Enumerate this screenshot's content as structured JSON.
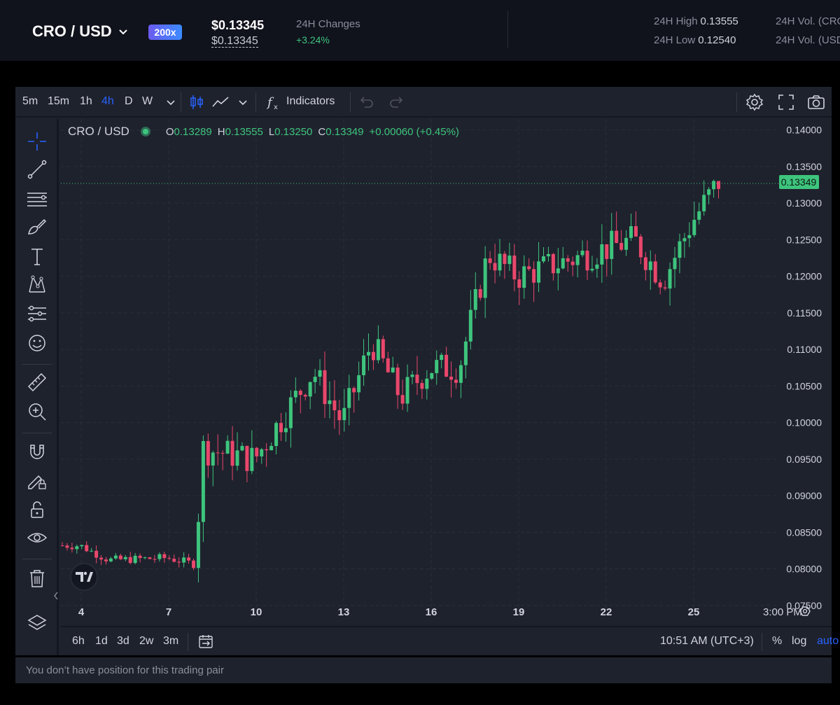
{
  "header": {
    "pair": "CRO / USD",
    "leverage": "200x",
    "price": "$0.13345",
    "price_sub": "$0.13345",
    "changes_label": "24H Changes",
    "changes_value": "+3.24%",
    "high_label": "24H High",
    "high_value": "0.13555",
    "low_label": "24H Low",
    "low_value": "0.12540",
    "vol1_label": "24H Vol. (CRO",
    "vol2_label": "24H Vol. (USD"
  },
  "toolbar": {
    "intervals": [
      "5m",
      "15m",
      "1h",
      "4h",
      "D",
      "W"
    ],
    "active_interval": "4h",
    "indicators_label": "Indicators"
  },
  "legend": {
    "symbol": "CRO / USD",
    "o_label": "O",
    "o_value": "0.13289",
    "h_label": "H",
    "h_value": "0.13555",
    "l_label": "L",
    "l_value": "0.13250",
    "c_label": "C",
    "c_value": "0.13349",
    "change": "+0.00060 (+0.45%)"
  },
  "bottombar": {
    "ranges": [
      "6h",
      "1d",
      "3d",
      "2w",
      "3m"
    ],
    "time": "10:51 AM (UTC+3)",
    "percent": "%",
    "log": "log",
    "auto": "auto"
  },
  "position_message": "You don’t have position for this trading pair",
  "colors": {
    "up": "#3ec47d",
    "down": "#e9476b",
    "accent": "#2962ff"
  },
  "chart_data": {
    "type": "candlestick",
    "ylim": [
      0.0745,
      0.1415
    ],
    "y_ticks": [
      "0.14000",
      "0.13500",
      "0.13000",
      "0.12500",
      "0.12000",
      "0.11500",
      "0.11000",
      "0.10500",
      "0.10000",
      "0.09500",
      "0.09000",
      "0.08500",
      "0.08000",
      "0.07500"
    ],
    "x_ticks": [
      "4",
      "7",
      "10",
      "13",
      "16",
      "19",
      "22",
      "25",
      "3:00 PM"
    ],
    "last_price": 0.13349,
    "last_price_label": "0.13349",
    "key_closes": [
      {
        "day": "4",
        "close": 0.0832
      },
      {
        "day": "5",
        "close": 0.0812
      },
      {
        "day": "7",
        "close": 0.0815
      },
      {
        "day": "8",
        "close": 0.0806
      },
      {
        "day": "8",
        "close": 0.0965
      },
      {
        "day": "10",
        "close": 0.095
      },
      {
        "day": "12",
        "close": 0.107
      },
      {
        "day": "13",
        "close": 0.1
      },
      {
        "day": "14",
        "close": 0.111
      },
      {
        "day": "15",
        "close": 0.1035
      },
      {
        "day": "16",
        "close": 0.1075
      },
      {
        "day": "17",
        "close": 0.1075
      },
      {
        "day": "18",
        "close": 0.123
      },
      {
        "day": "19",
        "close": 0.12
      },
      {
        "day": "21",
        "close": 0.1225
      },
      {
        "day": "23",
        "close": 0.125
      },
      {
        "day": "24",
        "close": 0.1195
      },
      {
        "day": "25",
        "close": 0.1275
      },
      {
        "day": "26",
        "close": 0.13349
      }
    ]
  }
}
